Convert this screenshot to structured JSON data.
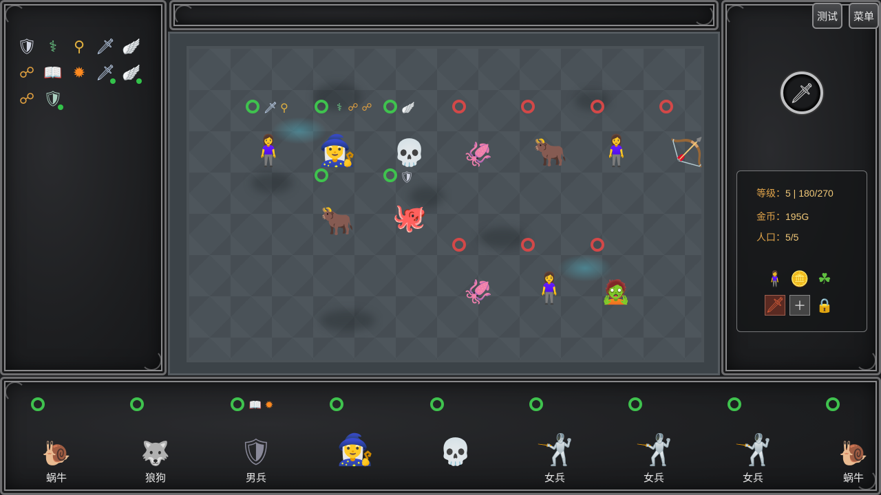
{
  "top_buttons": {
    "test": "测试",
    "menu": "菜单"
  },
  "stats": {
    "level_label": "等级：",
    "level_value": "5 | 180/270",
    "gold_label": "金币：",
    "gold_value": "195G",
    "pop_label": "人口：",
    "pop_value": "5/5"
  },
  "inventory_icons": [
    "shield-icon",
    "staff-icon",
    "ring-staff-icon",
    "sword-icon",
    "wings-icon",
    "amulet-icon",
    "spellbook-icon",
    "fire-burst-icon",
    "blade-icon",
    "wings-icon",
    "amulet-icon",
    "shield-icon"
  ],
  "bench": [
    {
      "name": "蜗牛",
      "unit": "snail"
    },
    {
      "name": "狼狗",
      "unit": "wolf"
    },
    {
      "name": "男兵",
      "unit": "male-soldier"
    },
    {
      "name": "",
      "unit": "witch"
    },
    {
      "name": "",
      "unit": "skeleton"
    },
    {
      "name": "女兵",
      "unit": "female-soldier"
    },
    {
      "name": "女兵",
      "unit": "female-soldier"
    },
    {
      "name": "女兵",
      "unit": "female-soldier"
    },
    {
      "name": "蜗牛",
      "unit": "snail"
    }
  ],
  "colors": {
    "ally_ring": "#3fc24e",
    "enemy_ring": "#d34848",
    "stat_text": "#e0a34a"
  }
}
